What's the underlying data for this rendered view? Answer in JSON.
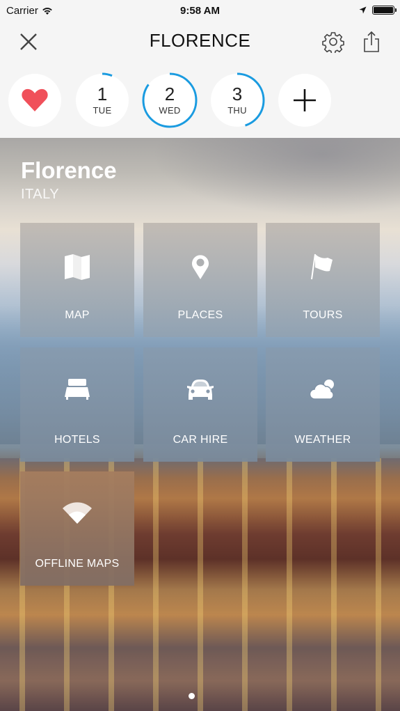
{
  "status_bar": {
    "carrier": "Carrier",
    "time": "9:58 AM",
    "icons": [
      "wifi-icon",
      "location-arrow-icon",
      "battery-icon"
    ]
  },
  "nav": {
    "title": "FLORENCE",
    "close_icon": "close-icon",
    "settings_icon": "gear-icon",
    "share_icon": "share-icon"
  },
  "days": {
    "favorite_icon": "heart-icon",
    "favorite_color": "#f0505a",
    "ring_color": "#1a9be0",
    "items": [
      {
        "number": "1",
        "name": "TUE",
        "progress": 0.06
      },
      {
        "number": "2",
        "name": "WED",
        "progress": 0.85
      },
      {
        "number": "3",
        "name": "THU",
        "progress": 0.45
      }
    ],
    "add_icon": "plus-icon"
  },
  "destination": {
    "city": "Florence",
    "country": "ITALY"
  },
  "tiles": [
    {
      "label": "MAP",
      "icon": "map-icon"
    },
    {
      "label": "PLACES",
      "icon": "map-pin-icon"
    },
    {
      "label": "TOURS",
      "icon": "flag-icon"
    },
    {
      "label": "HOTELS",
      "icon": "bed-icon"
    },
    {
      "label": "CAR HIRE",
      "icon": "car-icon"
    },
    {
      "label": "WEATHER",
      "icon": "cloud-sun-icon"
    },
    {
      "label": "OFFLINE MAPS",
      "icon": "wifi-icon"
    }
  ],
  "pager": {
    "pages": 1,
    "current": 1
  }
}
